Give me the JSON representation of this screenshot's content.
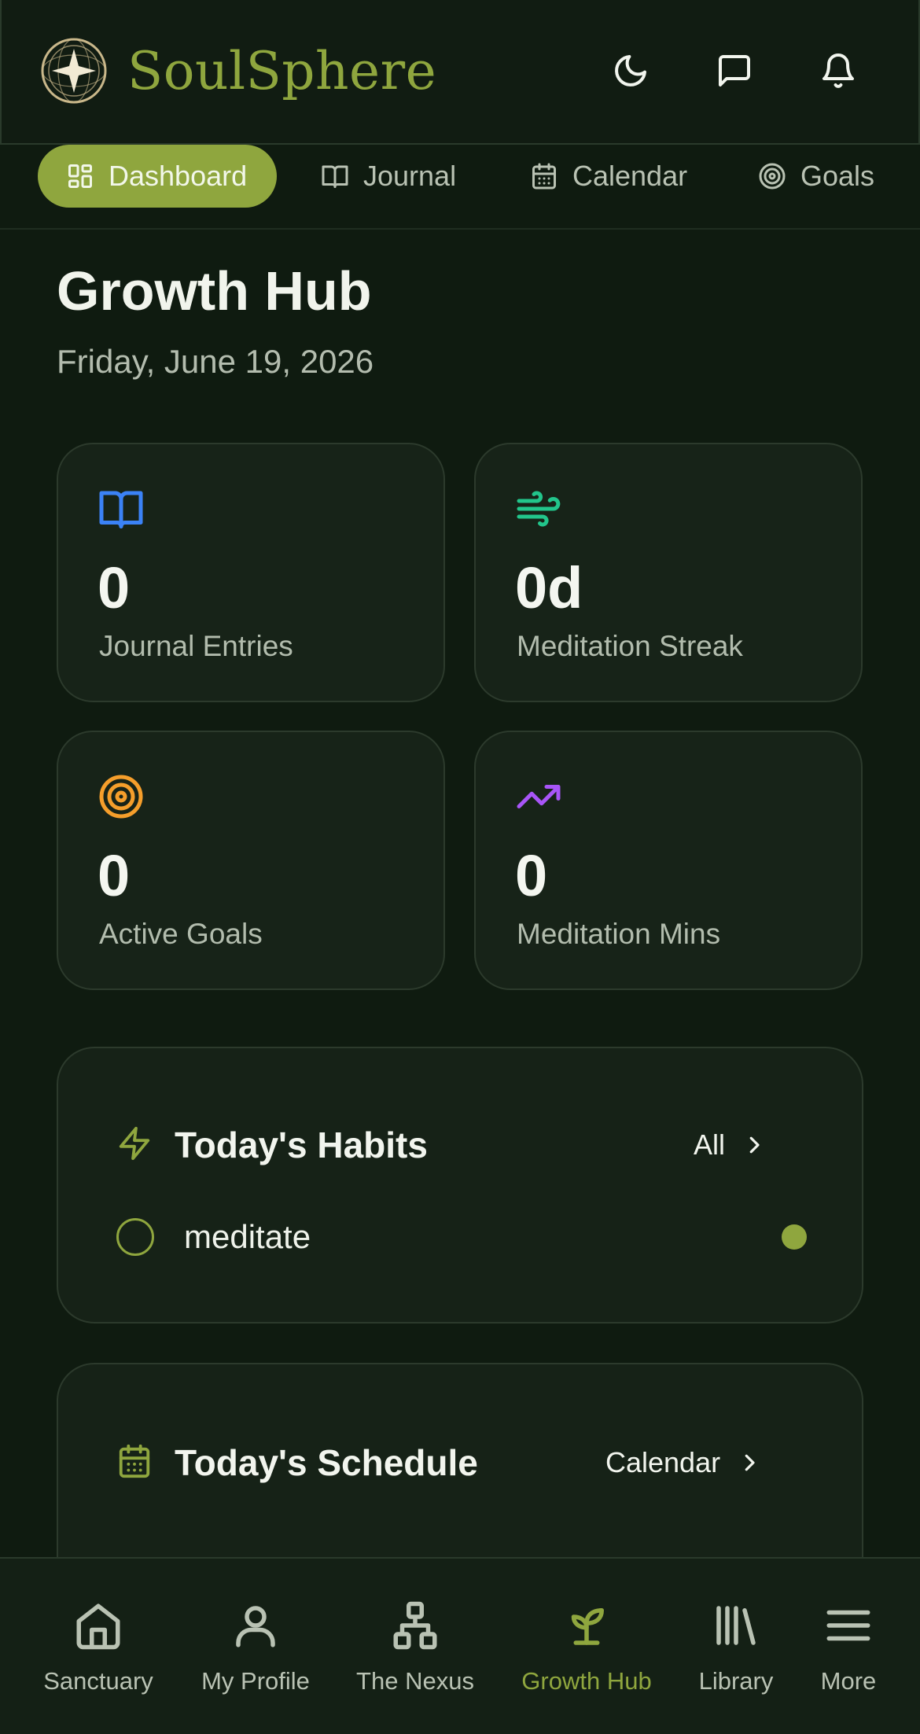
{
  "app": {
    "brand": "SoulSphere"
  },
  "header": {
    "icons": [
      "moon-icon",
      "message-icon",
      "bell-icon"
    ]
  },
  "tabs": [
    {
      "label": "Dashboard",
      "icon": "grid-icon",
      "active": true
    },
    {
      "label": "Journal",
      "icon": "book-icon"
    },
    {
      "label": "Calendar",
      "icon": "calendar-icon"
    },
    {
      "label": "Goals",
      "icon": "target-icon"
    }
  ],
  "page": {
    "title": "Growth Hub",
    "date": "Friday, June 19, 2026"
  },
  "stats": [
    {
      "value": "0",
      "label": "Journal Entries",
      "icon": "book-open-icon",
      "color": "#3b82f6"
    },
    {
      "value": "0d",
      "label": "Meditation Streak",
      "icon": "wind-icon",
      "color": "#22c58b"
    },
    {
      "value": "0",
      "label": "Active Goals",
      "icon": "target-icon",
      "color": "#f59e2b"
    },
    {
      "value": "0",
      "label": "Meditation Mins",
      "icon": "trending-up-icon",
      "color": "#a855f7"
    }
  ],
  "habits": {
    "title": "Today's Habits",
    "link": "All",
    "items": [
      {
        "name": "meditate"
      }
    ]
  },
  "schedule": {
    "title": "Today's Schedule",
    "link": "Calendar"
  },
  "bottom_nav": [
    {
      "label": "Sanctuary",
      "icon": "home-icon"
    },
    {
      "label": "My Profile",
      "icon": "user-icon"
    },
    {
      "label": "The Nexus",
      "icon": "network-icon"
    },
    {
      "label": "Growth Hub",
      "icon": "sprout-icon",
      "active": true
    },
    {
      "label": "Library",
      "icon": "library-icon"
    },
    {
      "label": "More",
      "icon": "menu-icon"
    }
  ],
  "colors": {
    "accent": "#8fa63e",
    "background": "#0f1b10",
    "card": "#162217"
  }
}
